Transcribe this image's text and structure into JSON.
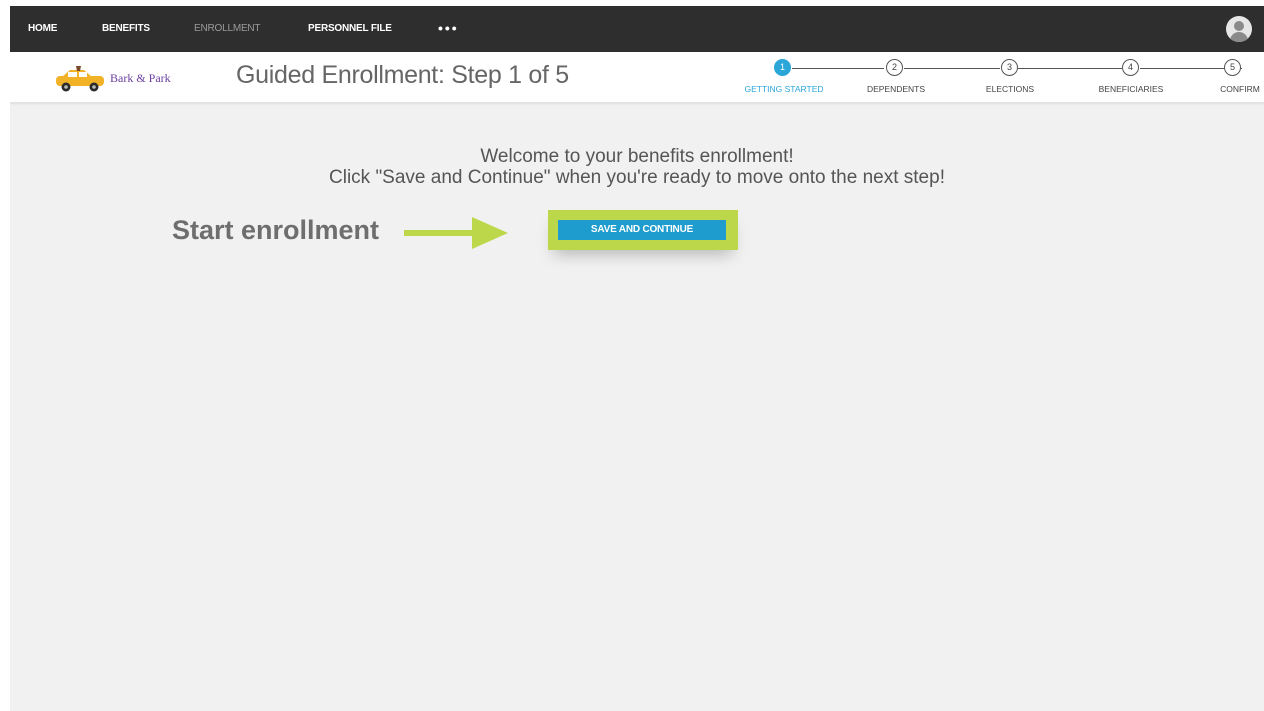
{
  "nav": {
    "items": [
      {
        "label": "HOME"
      },
      {
        "label": "BENEFITS"
      },
      {
        "label": "ENROLLMENT"
      },
      {
        "label": "PERSONNEL FILE"
      }
    ],
    "more_label": "•••",
    "avatar_icon": "user-avatar-icon"
  },
  "header": {
    "logo_text": "Bark & Park",
    "logo_icon": "taxi-car-icon",
    "title": "Guided Enrollment: Step 1 of 5"
  },
  "stepper": {
    "active_color": "#2aa6d8",
    "steps": [
      {
        "number": "1",
        "label": "GETTING STARTED",
        "active": true
      },
      {
        "number": "2",
        "label": "DEPENDENTS",
        "active": false
      },
      {
        "number": "3",
        "label": "ELECTIONS",
        "active": false
      },
      {
        "number": "4",
        "label": "BENEFICIARIES",
        "active": false
      },
      {
        "number": "5",
        "label": "CONFIRM",
        "active": false
      }
    ]
  },
  "main": {
    "welcome_line1": "Welcome to your benefits enrollment!",
    "welcome_line2": "Click \"Save and Continue\" when you're ready to move onto the next step!",
    "callout": "Start enrollment",
    "callout_arrow_icon": "arrow-right-icon",
    "save_button_label": "SAVE AND CONTINUE",
    "highlight_color": "#bcd84a",
    "button_color": "#1d9ccd"
  }
}
